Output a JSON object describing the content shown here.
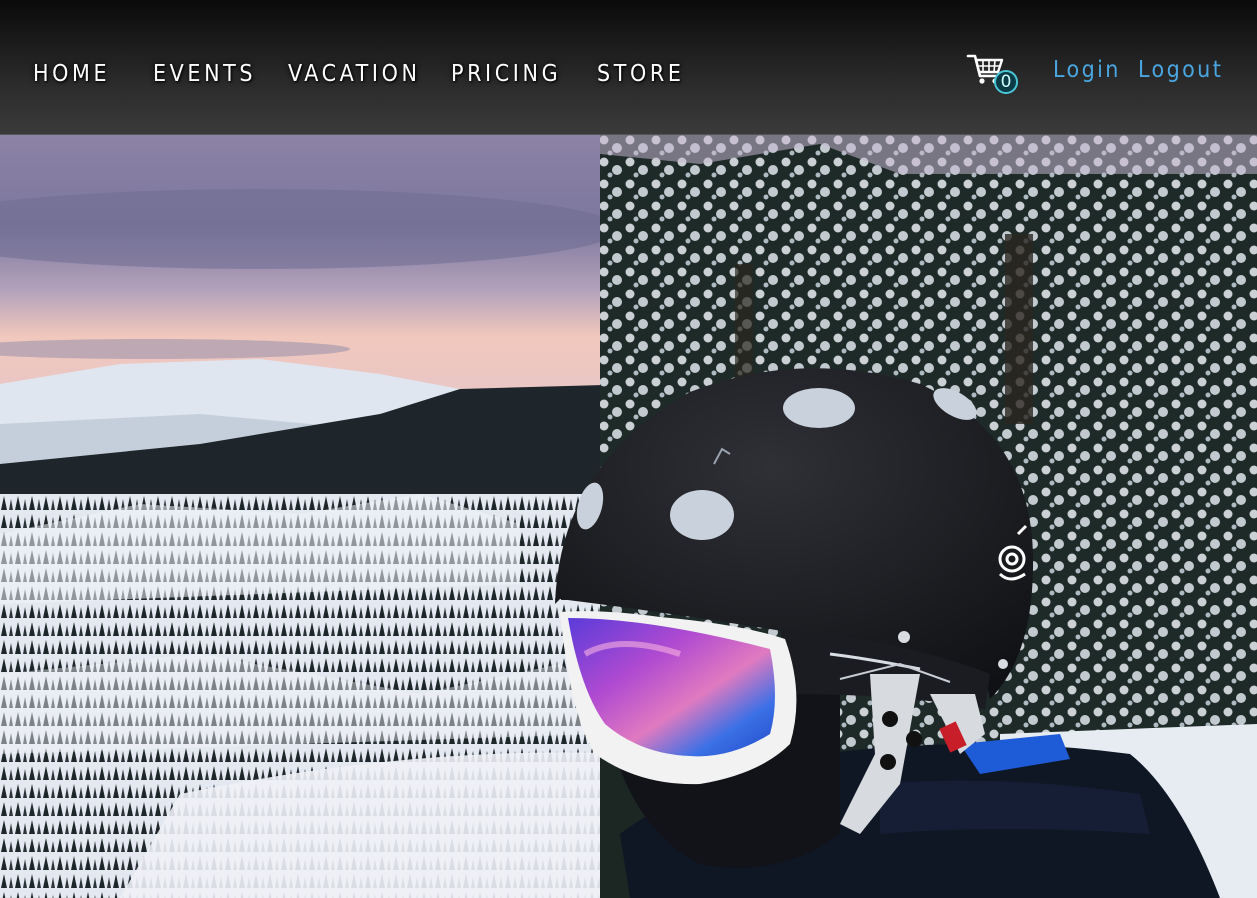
{
  "nav": {
    "items": [
      {
        "label": "HOME"
      },
      {
        "label": "EVENTS"
      },
      {
        "label": "VACATION"
      },
      {
        "label": "PRICING"
      },
      {
        "label": "STORE"
      }
    ]
  },
  "cart": {
    "icon": "shopping-cart-icon",
    "count": "0"
  },
  "auth": {
    "login_label": "Login",
    "logout_label": "Logout"
  },
  "colors": {
    "header_bg": "#1f1f1f",
    "nav_text": "#ffffff",
    "link_accent": "#4aa6e0",
    "badge_ring": "#49c7d6"
  }
}
